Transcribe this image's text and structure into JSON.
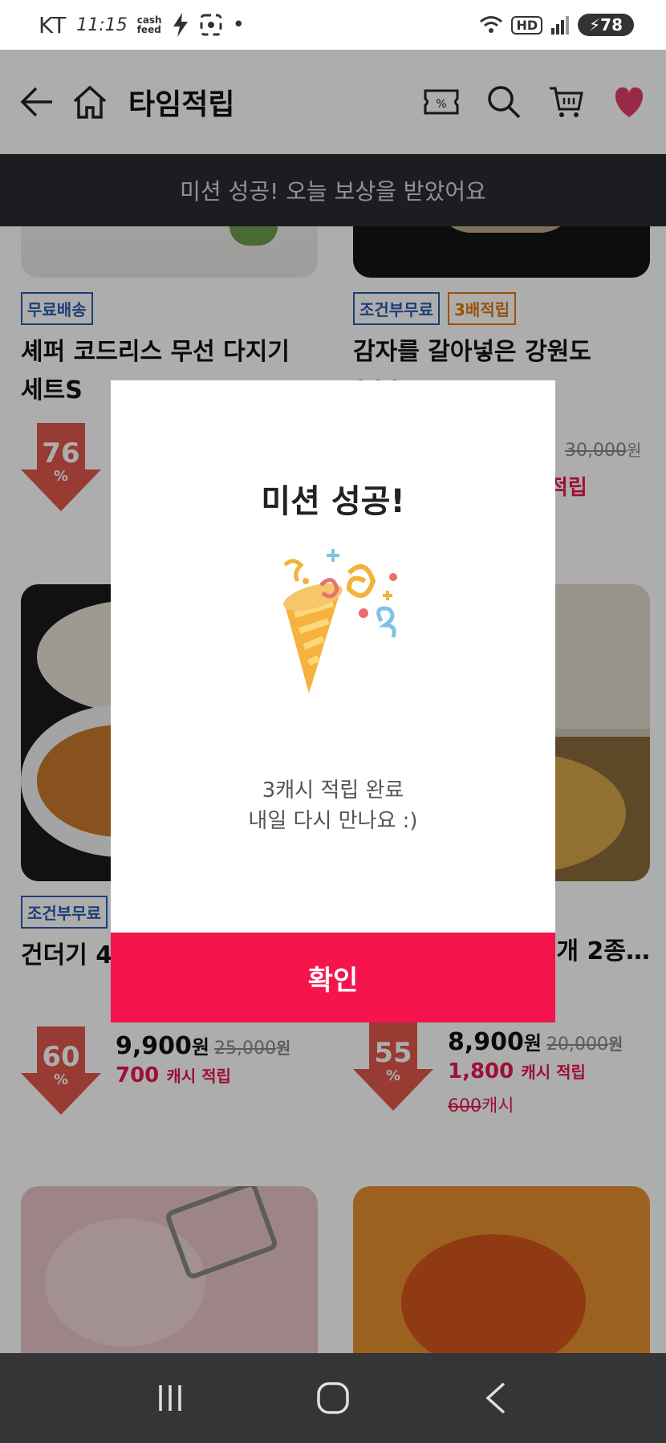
{
  "status_bar": {
    "carrier": "KT",
    "time": "11:15",
    "app_badge_top": "cash",
    "app_badge_bottom": "feed",
    "dot": "•",
    "hd": "HD",
    "battery": "78"
  },
  "header": {
    "title": "타임적립",
    "icons": [
      "back-arrow-icon",
      "home-icon",
      "coupon-icon",
      "search-icon",
      "cart-icon",
      "heart-icon"
    ],
    "heart_color": "#e33d6a"
  },
  "banner": {
    "text": "미션 성공! 오늘 보상을 받았어요"
  },
  "products": [
    {
      "tags": [
        "무료배송"
      ],
      "name": "셰퍼 코드리스 무선 다지기 세트S",
      "discount": "76",
      "pct": "%"
    },
    {
      "tags": [
        "조건부무료",
        "3배적립"
      ],
      "name": "감자를 갈아넣은 강원도 900…",
      "old_price": "30,000",
      "won": "원",
      "cash_label": "적립"
    },
    {
      "tags": [
        "조건부무료"
      ],
      "name": "건더기 4종 골라",
      "discount": "60",
      "pct": "%",
      "price": "9,900",
      "won": "원",
      "old_price": "25,000",
      "cash": "700",
      "cash_label": "캐시 적립"
    },
    {
      "tags": [],
      "name": "파주 장 개 2종…",
      "discount": "55",
      "pct": "%",
      "price": "8,900",
      "won": "원",
      "old_price": "20,000",
      "cash": "1,800",
      "cash_label": "캐시 적립",
      "extra_struck": "600",
      "extra_label": "캐시"
    }
  ],
  "dialog": {
    "title": "미션 성공!",
    "line1": "3캐시 적립 완료",
    "line2": "내일 다시 만나요 :)",
    "confirm": "확인",
    "confirm_color": "#f5144c"
  },
  "nav": [
    "recent-apps-icon",
    "home-circle-icon",
    "back-chevron-icon"
  ]
}
